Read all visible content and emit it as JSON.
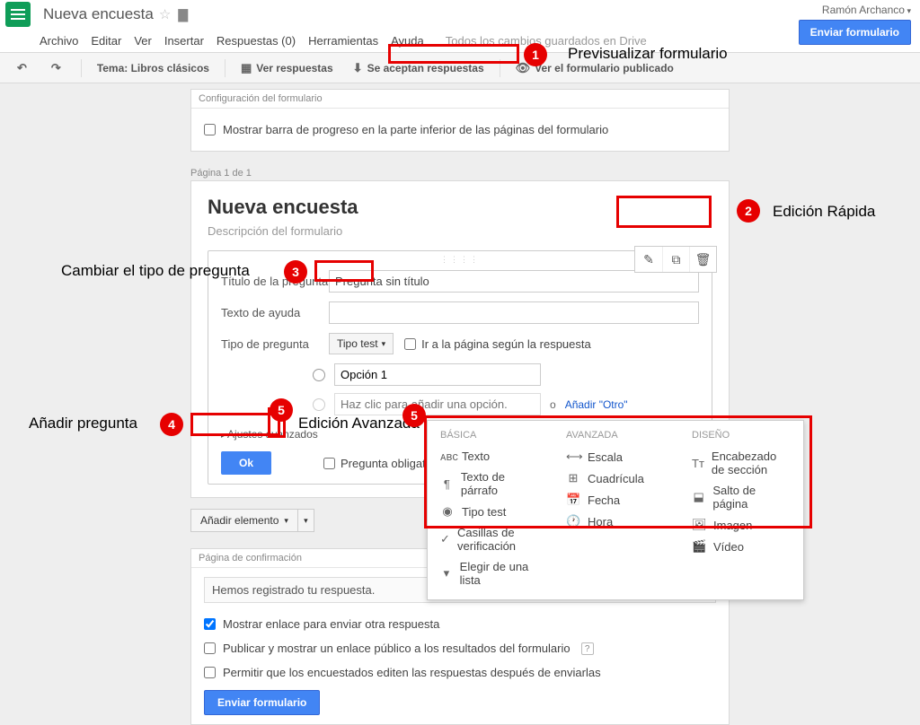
{
  "header": {
    "doc_title": "Nueva encuesta",
    "user_name": "Ramón Archanco",
    "send_button": "Enviar formulario"
  },
  "menubar": {
    "file": "Archivo",
    "edit": "Editar",
    "view": "Ver",
    "insert": "Insertar",
    "responses": "Respuestas (0)",
    "tools": "Herramientas",
    "help": "Ayuda",
    "save_status": "Todos los cambios guardados en Drive"
  },
  "toolbar": {
    "theme": "Tema: Libros clásicos",
    "view_responses": "Ver respuestas",
    "accepting": "Se aceptan respuestas",
    "view_live": "Ver el formulario publicado"
  },
  "config": {
    "header": "Configuración del formulario",
    "progress_bar": "Mostrar barra de progreso en la parte inferior de las páginas del formulario"
  },
  "page_label": "Página 1 de 1",
  "form": {
    "title": "Nueva encuesta",
    "desc": "Descripción del formulario"
  },
  "question": {
    "title_label": "Título de la pregunta",
    "title_value": "Pregunta sin título",
    "help_label": "Texto de ayuda",
    "type_label": "Tipo de pregunta",
    "type_value": "Tipo test",
    "goto": "Ir a la página según la respuesta",
    "option1": "Opción 1",
    "add_option_ph": "Haz clic para añadir una opción.",
    "or": "o ",
    "add_other": "Añadir \"Otro\"",
    "advanced": "Ajustes avanzados",
    "ok": "Ok",
    "required": "Pregunta obligatoria"
  },
  "add_item": "Añadir elemento",
  "confirm": {
    "header": "Página de confirmación",
    "message": "Hemos registrado tu respuesta.",
    "show_link": "Mostrar enlace para enviar otra respuesta",
    "publish": "Publicar y mostrar un enlace público a los resultados del formulario",
    "allow_edit": "Permitir que los encuestados editen las respuestas después de enviarlas",
    "send": "Enviar formulario"
  },
  "dropdown": {
    "basic": "BÁSICA",
    "advanced": "AVANZADA",
    "design": "DISEÑO",
    "text": "Texto",
    "paragraph": "Texto de párrafo",
    "multiple": "Tipo test",
    "checkboxes": "Casillas de verificación",
    "list": "Elegir de una lista",
    "scale": "Escala",
    "grid": "Cuadrícula",
    "date": "Fecha",
    "time": "Hora",
    "section": "Encabezado de sección",
    "pagebreak": "Salto de página",
    "image": "Imagen",
    "video": "Vídeo"
  },
  "annotations": {
    "t1": "Previsualizar formulario",
    "t2": "Edición Rápida",
    "t3": "Cambiar el tipo de pregunta",
    "t4": "Añadir pregunta",
    "t5": "Edición Avanzada"
  }
}
